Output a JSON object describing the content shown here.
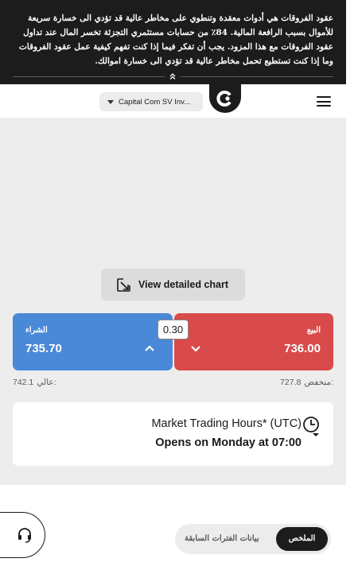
{
  "risk_warning": {
    "text": "عقود الفروقات هي أدوات معقدة وتنطوي على مخاطر عالية قد تؤدي الى خسارة سريعة للأموال بسبب الرافعة المالية. 84٪ من حسابات مستثمري التجزئة تخسر المال عند تداول عقود الفروقات مع هذا المزود. يجب أن تفكر فيما إذا كنت تفهم كيفية عمل عقود الفروقات وما إذا كنت تستطيع تحمل مخاطر عالية قد تؤدي الى خسارة اموالك.",
    "collapse_icon": "double-chevron-up-icon"
  },
  "header": {
    "account_selector": "Capital Com SV Inv...",
    "logo_icon": "capital-com-logo",
    "menu_icon": "hamburger-menu-icon"
  },
  "chart": {
    "button_label": "View detailed chart",
    "button_icon": "expand-arrow-icon"
  },
  "trade": {
    "buy_label": "الشراء",
    "buy_price": "735.70",
    "sell_label": "البيع",
    "sell_price": "736.00",
    "spread": "0.30"
  },
  "stats": {
    "high_label": "عالي:",
    "high_value": "742.1",
    "low_label": "منخفض:",
    "low_value": "727.8"
  },
  "market_hours": {
    "title": "Market Trading Hours* (UTC)",
    "status": "Opens on Monday at 07:00",
    "icon": "clock-icon"
  },
  "support": {
    "icon": "headset-icon"
  },
  "tabs": {
    "summary": "الملخص",
    "history": "بيانات الفترات السابقة"
  },
  "colors": {
    "buy": "#4a88d8",
    "sell": "#d94a4a",
    "dark": "#1c1c1c",
    "surface": "#ededed"
  }
}
